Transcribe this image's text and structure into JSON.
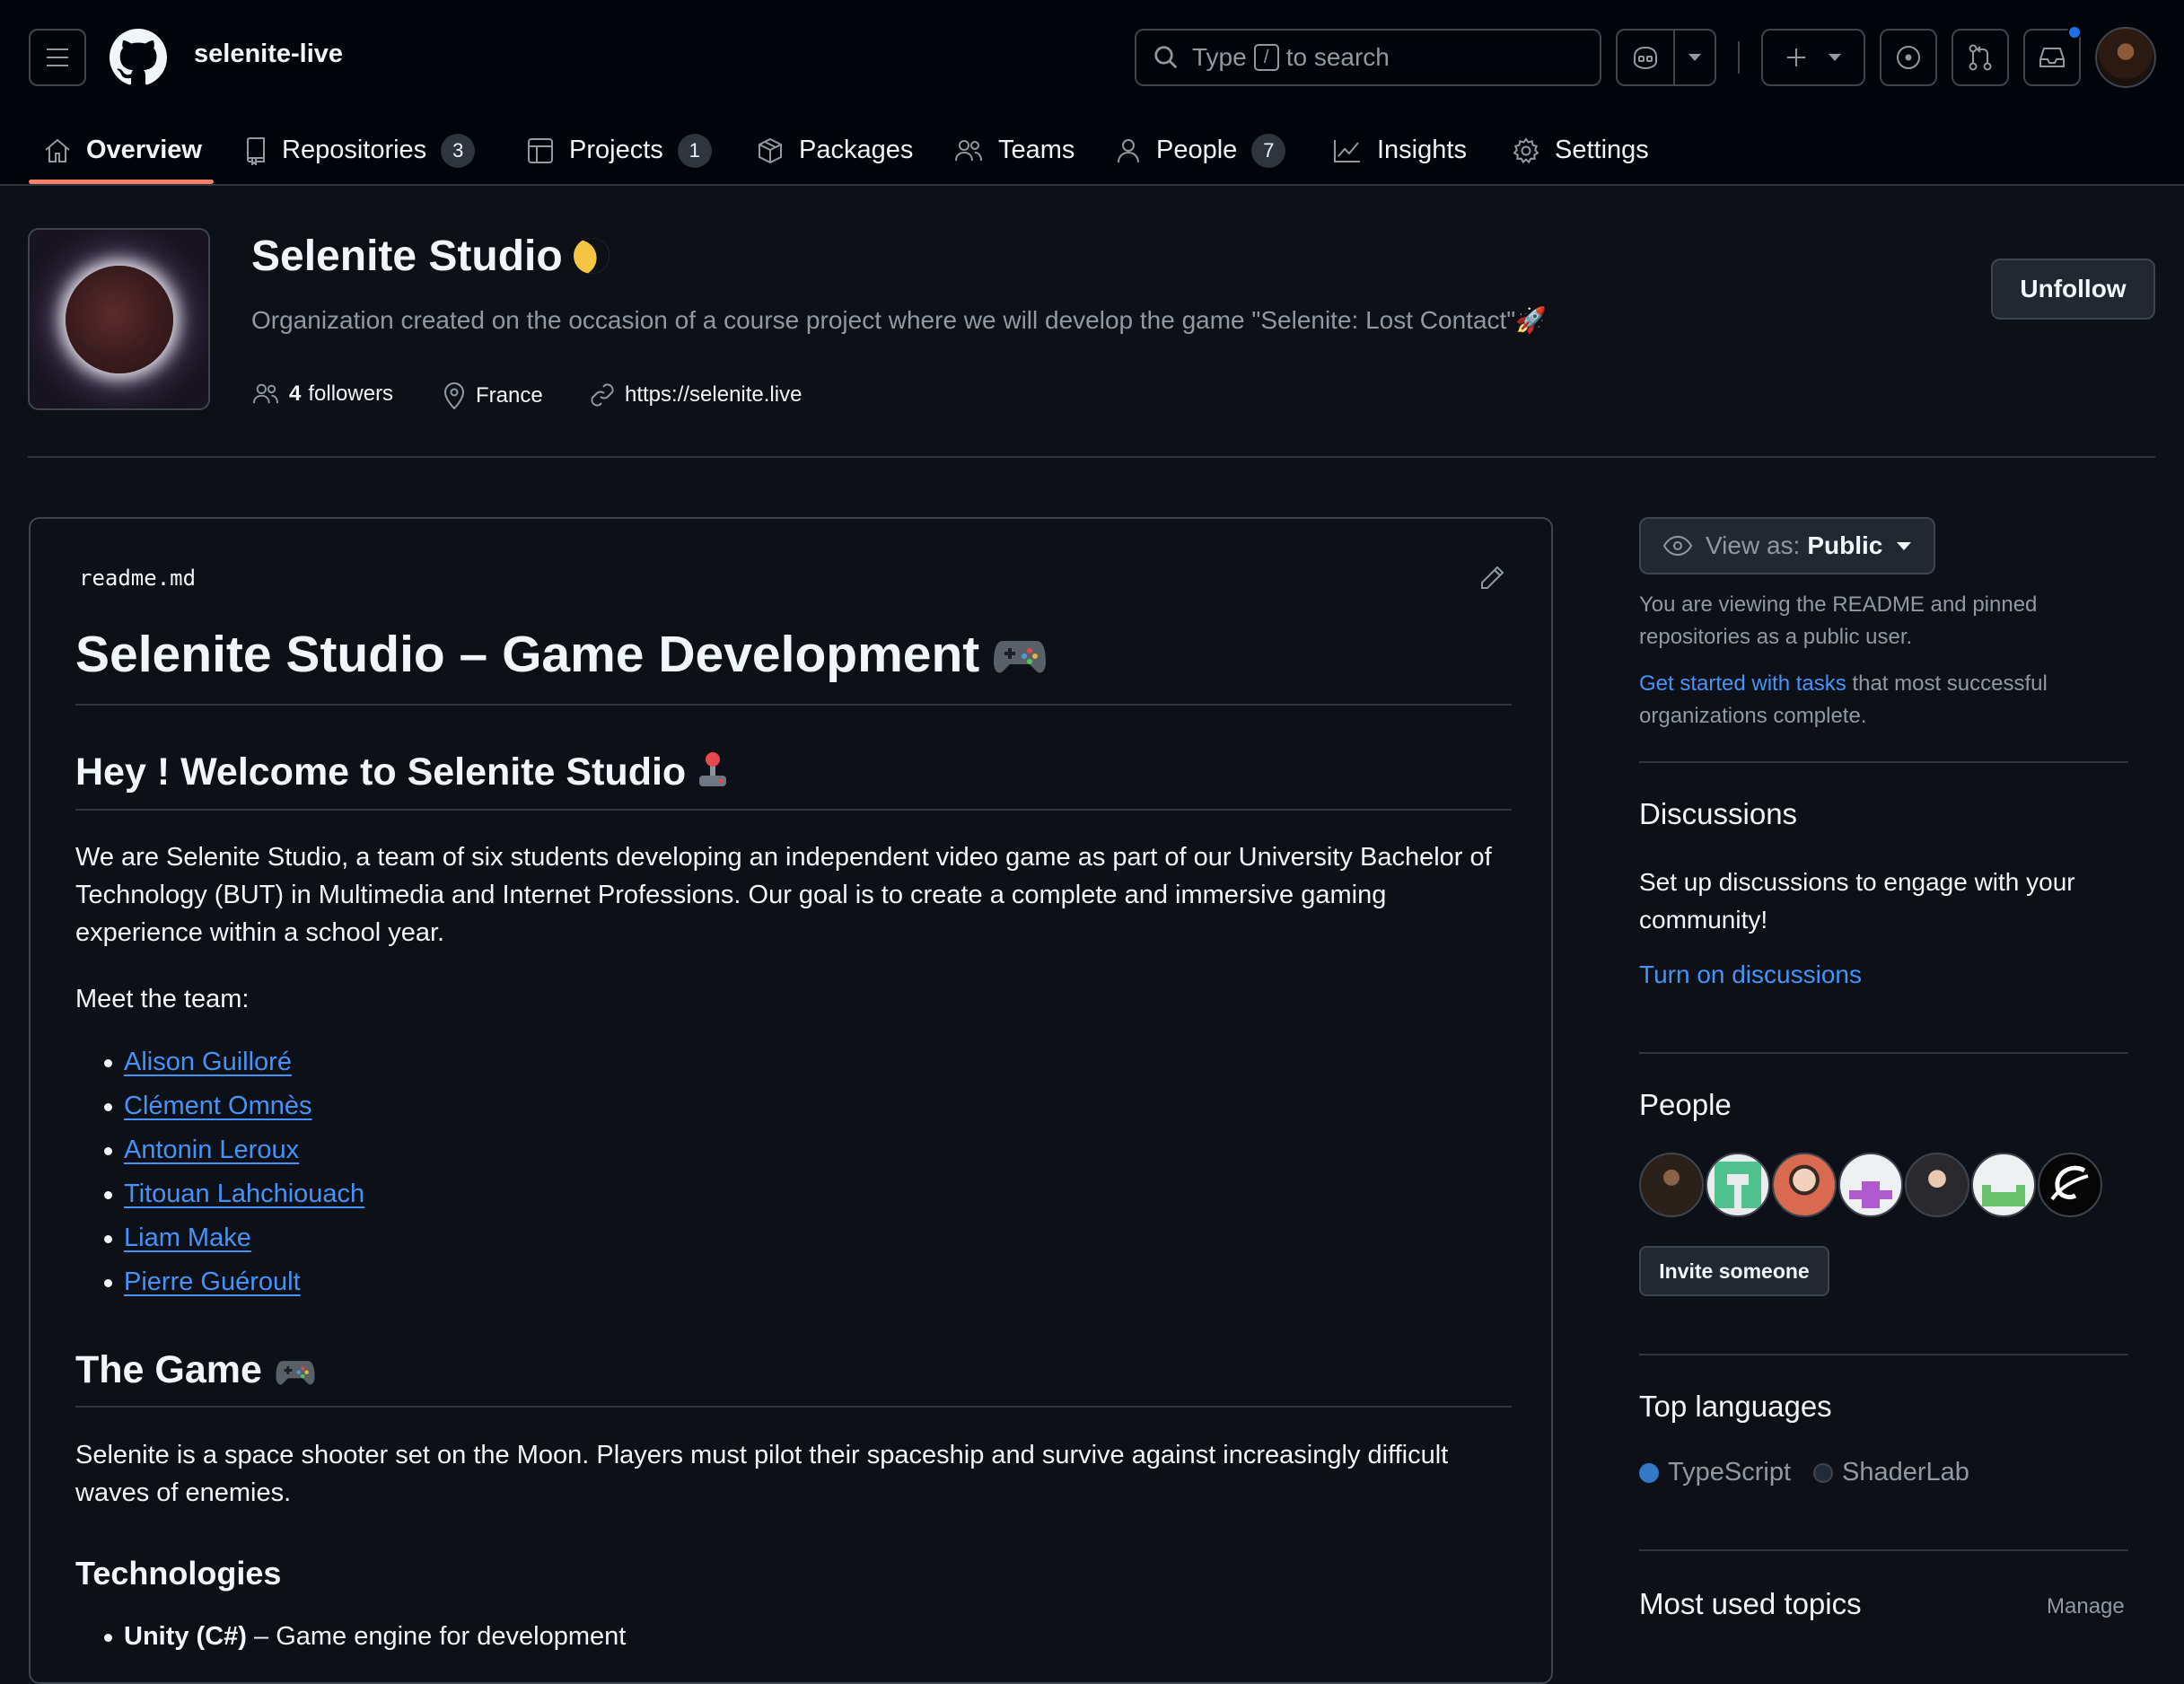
{
  "header": {
    "org_name": "selenite-live",
    "search_prefix": "Type",
    "search_key": "/",
    "search_suffix": "to search"
  },
  "nav": {
    "overview": "Overview",
    "repositories": "Repositories",
    "repositories_count": "3",
    "projects": "Projects",
    "projects_count": "1",
    "packages": "Packages",
    "teams": "Teams",
    "people": "People",
    "people_count": "7",
    "insights": "Insights",
    "settings": "Settings"
  },
  "profile": {
    "title": "Selenite Studio",
    "description": "Organization created on the occasion of a course project where we will develop the game \"Selenite: Lost Contact\"🚀",
    "followers_count": "4",
    "followers_label": "followers",
    "location": "France",
    "website": "https://selenite.live",
    "unfollow_label": "Unfollow"
  },
  "readme": {
    "filename": "readme.md",
    "h1": "Selenite Studio – Game Development",
    "h2_welcome": "Hey ! Welcome to Selenite Studio",
    "intro_line1": "We are Selenite Studio, a team of six students developing an independent video game as part of our University Bachelor of",
    "intro_line2": "Technology (BUT) in Multimedia and Internet Professions. Our goal is to create a complete and immersive gaming",
    "intro_line3": "experience within a school year.",
    "meet_team": "Meet the team:",
    "team": [
      "Alison Guilloré",
      "Clément Omnès",
      "Antonin Leroux",
      "Titouan Lahchiouach",
      "Liam Make",
      "Pierre Guéroult"
    ],
    "h2_game": "The Game",
    "game_line1": "Selenite is a space shooter set on the Moon. Players must pilot their spaceship and survive against increasingly difficult",
    "game_line2": "waves of enemies.",
    "h3_tech": "Technologies",
    "tech_1_bold": "Unity (C#)",
    "tech_1_rest": " – Game engine for development"
  },
  "sidebar": {
    "view_as_label": "View as:",
    "view_as_value": "Public",
    "readme_note_line1": "You are viewing the README and pinned",
    "readme_note_line2": "repositories as a public user.",
    "tasks_link": "Get started with tasks",
    "tasks_rest_line1": " that most successful",
    "tasks_rest_line2": "organizations complete.",
    "discussions_title": "Discussions",
    "discussions_line1": "Set up discussions to engage with your",
    "discussions_line2": "community!",
    "discussions_link": "Turn on discussions",
    "people_title": "People",
    "invite_label": "Invite someone",
    "languages_title": "Top languages",
    "languages": [
      {
        "name": "TypeScript",
        "color": "#3178c6"
      },
      {
        "name": "ShaderLab",
        "color": "#222c37"
      }
    ],
    "topics_title": "Most used topics",
    "manage_label": "Manage"
  },
  "colors": {
    "accent": "#f78166",
    "link": "#4493f8",
    "background": "#0d1117"
  }
}
